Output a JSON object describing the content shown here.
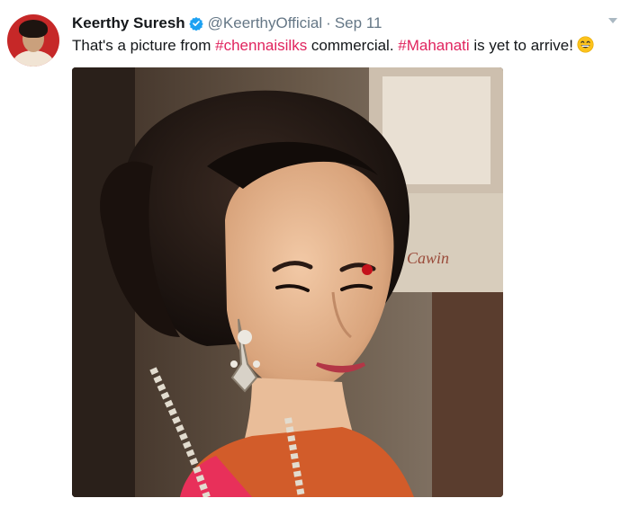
{
  "tweet": {
    "author_name": "Keerthy Suresh",
    "handle": "@KeerthyOfficial",
    "separator": "·",
    "date": "Sep 11",
    "text_parts": {
      "p1": "That's a picture from ",
      "tag1": "#chennaisilks",
      "p2": " commercial. ",
      "tag2": "#Mahanati",
      "p3": " is yet to arrive!"
    },
    "emoji_icon": "grinning-face-icon",
    "box_text": "Cawin",
    "colors": {
      "hashtag": "#e0245e",
      "verified": "#1da1f2",
      "name": "#14171a",
      "meta": "#657786"
    }
  }
}
